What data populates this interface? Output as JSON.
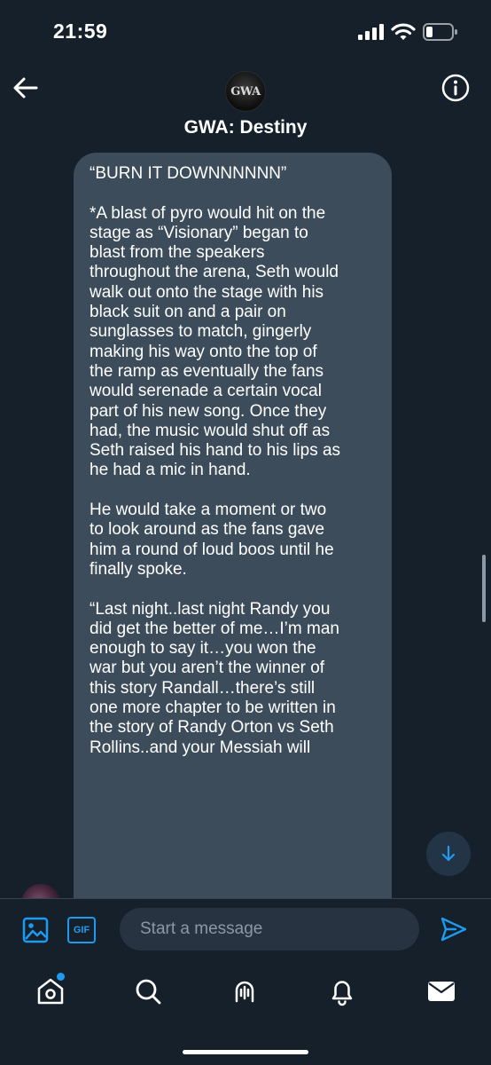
{
  "status_bar": {
    "time": "21:59",
    "icons": [
      "signal-icon",
      "wifi-icon",
      "battery-icon"
    ]
  },
  "header": {
    "avatar_text": "GWA",
    "title": "GWA: Destiny",
    "icons": [
      "back-arrow-icon",
      "info-icon"
    ]
  },
  "message": {
    "paragraphs": [
      "“BURN IT DOWNNNNNN”",
      "*A blast of pyro would hit on the\nstage as “Visionary” began to\nblast from the speakers\nthroughout the arena, Seth would\nwalk out onto the stage with his\nblack suit on and a pair on\nsunglasses to match, gingerly\nmaking his way onto the top of\nthe ramp as eventually the fans\nwould serenade a certain vocal\npart of his new song. Once they\nhad, the music would shut off as\nSeth raised his hand to his lips as\nhe had a mic in hand.",
      "He would take a moment or two\nto look around as the fans gave\nhim a round of loud boos until he\nfinally spoke.",
      "“Last night..last night Randy you\ndid get the better of me…I’m man\nenough to say it…you won the\nwar but you aren’t the winner of\nthis story Randall…there’s still\none more chapter to be written in\nthe story of Randy Orton vs Seth\nRollins..and your Messiah will"
    ]
  },
  "composer": {
    "placeholder": "Start a message",
    "gif_label": "GIF",
    "icons": [
      "image-icon",
      "gif-icon",
      "send-icon"
    ]
  },
  "tab_bar": {
    "tabs": [
      "home",
      "search",
      "spaces",
      "notifications",
      "messages"
    ],
    "home_has_new": true,
    "active_tab": "messages"
  },
  "colors": {
    "background": "#15202b",
    "bubble": "#3d4c5b",
    "accent": "#1d9bf0",
    "input_background": "#273340",
    "muted_text": "#8b98a5"
  }
}
